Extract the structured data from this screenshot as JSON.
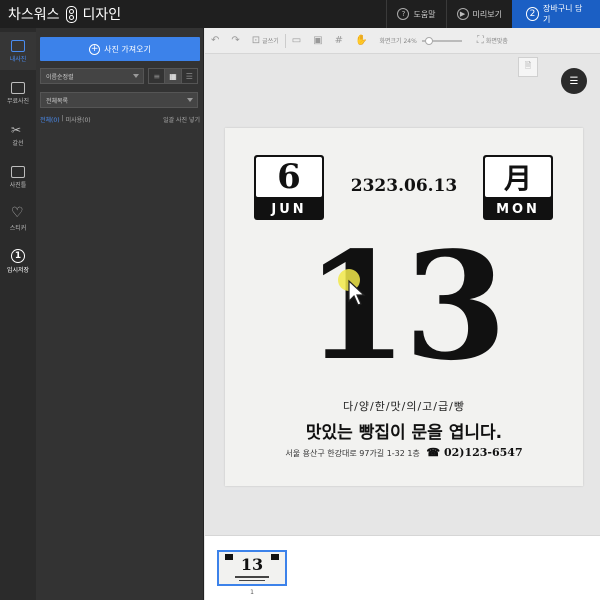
{
  "app": {
    "logo_left": "차스워스",
    "logo_right": "디자인",
    "help_label": "도움말",
    "preview_label": "미리보기",
    "cart_number": "2",
    "cart_label": "장바구니 담기"
  },
  "rail": {
    "items": [
      {
        "label": "내사진"
      },
      {
        "label": "무료사진"
      },
      {
        "label": "갈선"
      },
      {
        "label": "사진틀"
      },
      {
        "label": "스티커"
      },
      {
        "label": "임시저장",
        "number": "1"
      }
    ]
  },
  "panel": {
    "upload_label": "사진 가져오기",
    "sort_value": "이름순정렬",
    "folder_value": "전체목록",
    "filter_all": "전체(0)",
    "filter_unused": "미사용(0)",
    "bulk_insert": "일괄 사진 넣기"
  },
  "toolbar": {
    "text_tool": "글쓰기",
    "zoom_label": "화면크기 24%",
    "fit_label": "화면맞춤"
  },
  "design": {
    "left_card_top": "6",
    "left_card_bottom": "JUN",
    "date": "2323.06.13",
    "right_card_top": "月",
    "right_card_bottom": "MON",
    "day": "13",
    "subline": "다/양/한/맛/의/고/급/빵",
    "headline": "맛있는 빵집이 문을 엽니다.",
    "address": "서울 용산구 한강대로 97가길 1-32 1층",
    "phone": "☎ 02)123-6547"
  },
  "thumbnails": {
    "page_label": "1",
    "mini_day": "13"
  },
  "colors": {
    "accent": "#3c82ea",
    "cart_bg": "#1b5fc4",
    "topbar_bg": "#1f1f1f",
    "panel_bg": "#333333",
    "rail_bg": "#2b2b2b"
  }
}
